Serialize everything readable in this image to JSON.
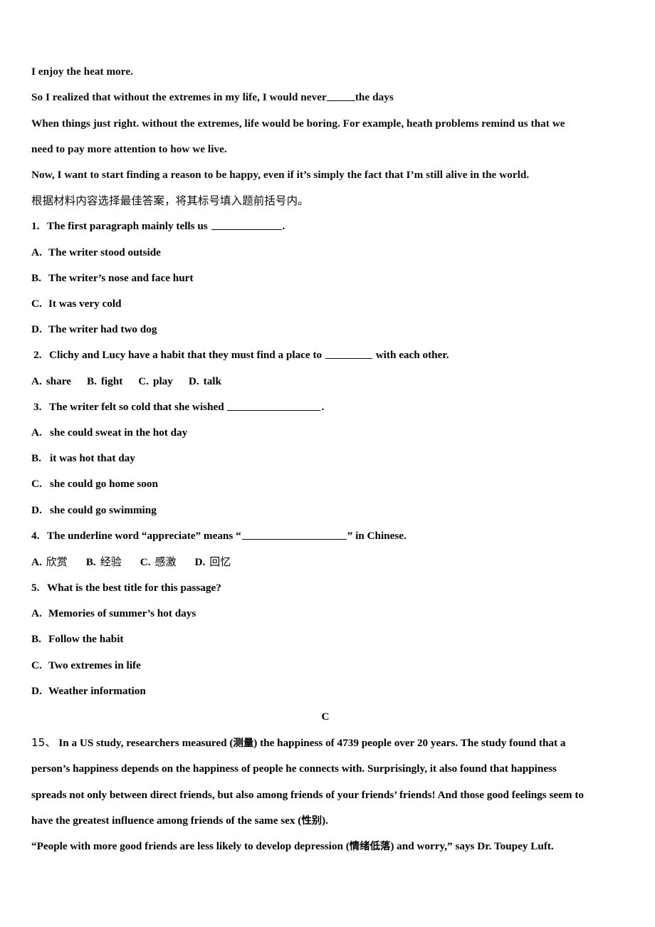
{
  "document": {
    "passage": {
      "lines": [
        "I enjoy the heat more.",
        "So I realized that without the extremes in my life, I would never",
        "the days",
        "When things just right. without the extremes, life would be boring. For example, heath problems remind us that we need to pay more attention to how we live.",
        "Now, I want to start finding a reason to be happy, even if it’s simply the fact that I’m still alive in the world."
      ],
      "line1": "I enjoy the heat more.",
      "line2_before_blank": "So I realized that without the extremes in my life, I would never",
      "line2_after_blank": "the days",
      "line3": "When things just right. without the extremes, life would be boring. For example, heath problems remind us that we",
      "line4": "need to pay more attention to how we live.",
      "line5": "Now, I want to start finding a reason to be happy, even if it’s simply the fact that I’m still alive in the world."
    },
    "instruction_cn": "根据材料内容选择最佳答案，将其标号填入题前括号内。",
    "questions": [
      {
        "number": "1.",
        "stem_before_blank": "The first paragraph mainly tells us",
        "stem_after_blank": ".",
        "layout": "stacked",
        "options": [
          {
            "label": "A.",
            "text": "The writer stood outside"
          },
          {
            "label": "B.",
            "text": "The writer’s nose and face hurt"
          },
          {
            "label": "C.",
            "text": "It was very cold"
          },
          {
            "label": "D.",
            "text": "The writer had two dog"
          }
        ]
      },
      {
        "number": "2.",
        "stem_before_blank": "Clichy and Lucy have a habit that they must find a place to",
        "stem_after_blank": "with each other.",
        "layout": "inline",
        "options": [
          {
            "label": "A.",
            "text": "share"
          },
          {
            "label": "B.",
            "text": "fight"
          },
          {
            "label": "C.",
            "text": "play"
          },
          {
            "label": "D.",
            "text": "talk"
          }
        ]
      },
      {
        "number": "3.",
        "stem_before_blank": "The writer felt so cold that she wished",
        "stem_after_blank": ".",
        "layout": "stacked",
        "options": [
          {
            "label": "A.",
            "text": "she could sweat in the hot day"
          },
          {
            "label": "B.",
            "text": "it was hot that day"
          },
          {
            "label": "C.",
            "text": "she could go home soon"
          },
          {
            "label": "D.",
            "text": "she could go swimming"
          }
        ]
      },
      {
        "number": "4.",
        "stem_before_blank": "The underline word “appreciate” means “",
        "stem_after_blank": "” in Chinese.",
        "layout": "inline-cn",
        "options": [
          {
            "label": "A.",
            "text": "欣赏"
          },
          {
            "label": "B.",
            "text": "经验"
          },
          {
            "label": "C.",
            "text": "感激"
          },
          {
            "label": "D.",
            "text": "回忆"
          }
        ]
      },
      {
        "number": "5.",
        "stem_before_blank": "What is the best title for this passage?",
        "stem_after_blank": "",
        "layout": "stacked-noblank",
        "options": [
          {
            "label": "A.",
            "text": "Memories of summer’s hot days"
          },
          {
            "label": "B.",
            "text": "Follow the habit"
          },
          {
            "label": "C.",
            "text": "Two extremes in life"
          },
          {
            "label": "D.",
            "text": "Weather information"
          }
        ]
      }
    ],
    "answer_mark": "C",
    "question15": {
      "number": "15、",
      "line1_a": "In a US study, researchers measured (",
      "line1_cjk": "测量",
      "line1_b": ") the happiness of 4739 people over 20 years. The study found that a",
      "line2": "person’s happiness depends on the happiness of people he connects with. Surprisingly, it also found that happiness",
      "line3": "spreads not only between direct friends, but also among friends of your friends’ friends! And those good feelings seem to",
      "line4_a": "have the greatest influence among friends of the same sex (",
      "line4_cjk": "性别",
      "line4_b": ").",
      "line5_a": "“People with more good friends are less likely to develop depression (",
      "line5_cjk": "情绪低落",
      "line5_b": ") and worry,” says Dr. Toupey Luft."
    }
  },
  "colors": {
    "text": "#0b0b0b",
    "background": "#ffffff"
  }
}
